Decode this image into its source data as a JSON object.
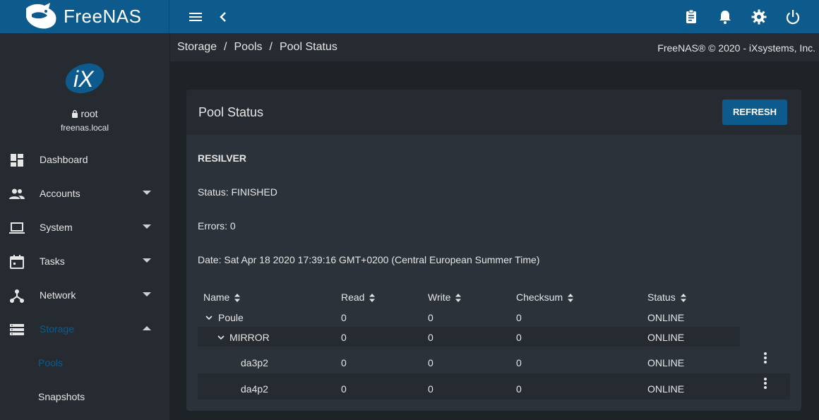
{
  "app": {
    "logo_text": "FreeNAS"
  },
  "topbar": {
    "icons": [
      "menu-icon",
      "chevron-left-icon",
      "clipboard-icon",
      "bell-icon",
      "gear-icon",
      "power-icon"
    ]
  },
  "user": {
    "logo_text": "iX",
    "name": "root",
    "host": "freenas.local"
  },
  "sidebar": {
    "items": [
      {
        "label": "Dashboard",
        "icon": "dashboard-icon"
      },
      {
        "label": "Accounts",
        "icon": "people-icon"
      },
      {
        "label": "System",
        "icon": "laptop-icon"
      },
      {
        "label": "Tasks",
        "icon": "calendar-icon"
      },
      {
        "label": "Network",
        "icon": "network-icon"
      },
      {
        "label": "Storage",
        "icon": "storage-icon"
      }
    ],
    "sub_items": [
      {
        "label": "Pools"
      },
      {
        "label": "Snapshots"
      }
    ]
  },
  "breadcrumb": {
    "items": [
      "Storage",
      "Pools",
      "Pool Status"
    ],
    "separator": "/"
  },
  "copyright": "FreeNAS® © 2020 - iXsystems, Inc.",
  "card": {
    "title": "Pool Status",
    "refresh_label": "REFRESH",
    "resilver_label": "RESILVER",
    "status_text": "Status: FINISHED",
    "errors_text": "Errors: 0",
    "date_text": "Date: Sat Apr 18 2020 17:39:16 GMT+0200 (Central European Summer Time)"
  },
  "table": {
    "headers": [
      "Name",
      "Read",
      "Write",
      "Checksum",
      "Status"
    ],
    "rows": [
      {
        "name": "Poule",
        "read": "0",
        "write": "0",
        "checksum": "0",
        "status": "ONLINE"
      },
      {
        "name": "MIRROR",
        "read": "0",
        "write": "0",
        "checksum": "0",
        "status": "ONLINE"
      },
      {
        "name": "da3p2",
        "read": "0",
        "write": "0",
        "checksum": "0",
        "status": "ONLINE"
      },
      {
        "name": "da4p2",
        "read": "0",
        "write": "0",
        "checksum": "0",
        "status": "ONLINE"
      }
    ]
  },
  "colors": {
    "accent": "#0d5a8c",
    "background": "#1e2328",
    "sidebar": "#262b31",
    "card": "#2c323a",
    "text": "#e6e6e6"
  }
}
